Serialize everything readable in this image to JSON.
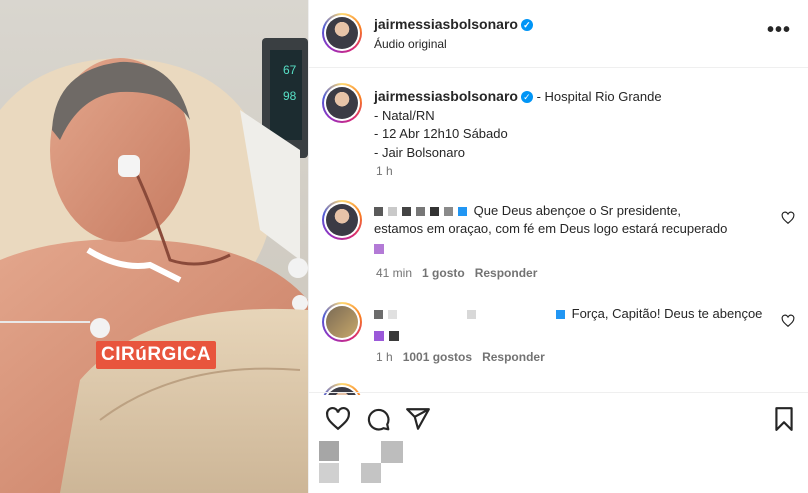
{
  "media": {
    "badge_text": "CIRúRGICA"
  },
  "header": {
    "username": "jairmessiasbolsonaro",
    "audio": "Áudio original",
    "more": "•••",
    "verified": "✓"
  },
  "caption": {
    "username": "jairmessiasbolsonaro",
    "location": "- Hospital Rio Grande",
    "lines": [
      "- Natal/RN",
      "- 12 Abr 12h10 Sábado",
      "- Jair Bolsonaro"
    ],
    "time": "1 h"
  },
  "comments": [
    {
      "text_line1": "Que Deus abençoe o Sr presidente,",
      "text_line2": "estamos em oraçao, com fé em Deus logo estará recuperado",
      "time": "41 min",
      "likes": "1 gosto",
      "reply": "Responder"
    },
    {
      "text_line1": "Força, Capitão! Deus te abençoe",
      "time": "1 h",
      "likes": "1001 gostos",
      "reply": "Responder"
    }
  ],
  "colors": {
    "accent": "#0095f6",
    "text": "#262626",
    "muted": "#737373",
    "badge": "#e8553d"
  },
  "icons": [
    "heart-icon",
    "comment-icon",
    "share-icon",
    "bookmark-icon",
    "more-icon"
  ]
}
